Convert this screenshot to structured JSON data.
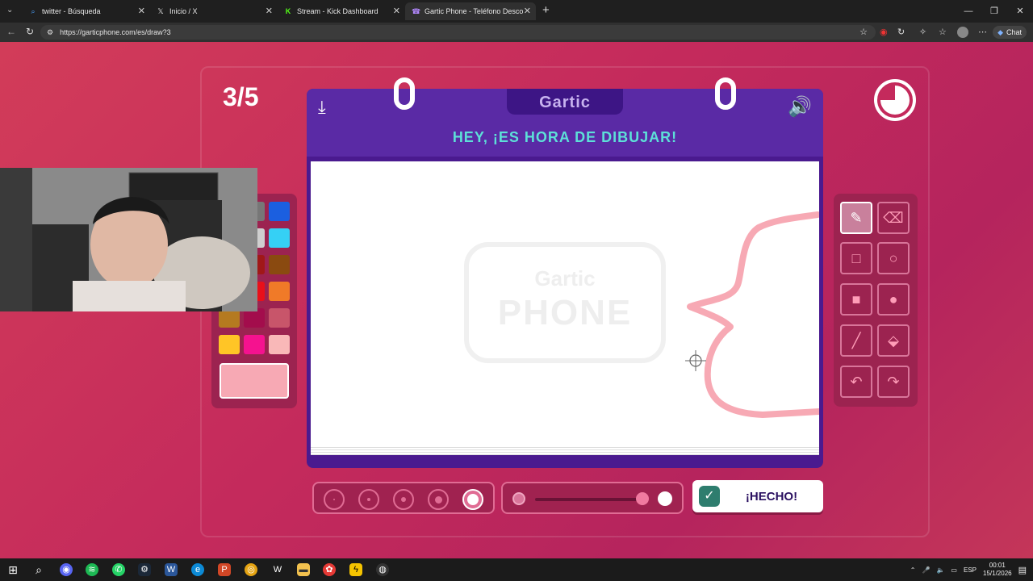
{
  "browser": {
    "tabs": [
      {
        "title": "twitter - Búsqueda",
        "favicon": "search-icon"
      },
      {
        "title": "Inicio / X",
        "favicon": "x-icon"
      },
      {
        "title": "Stream - Kick Dashboard",
        "favicon": "kick-icon"
      },
      {
        "title": "Gartic Phone - Teléfono Descomp",
        "favicon": "gartic-icon",
        "active": true
      }
    ],
    "new_tab": "+",
    "url": "https://garticphone.com/es/draw?3",
    "chat_label": "Chat"
  },
  "game": {
    "round": "3/5",
    "logo": "Gartic",
    "headline": "HEY, ¡ES HORA DE DIBUJAR!",
    "watermark_top": "Gartic",
    "watermark_bottom": "PHONE",
    "done_label": "¡HECHO!",
    "selected_color": "#f7a9b4",
    "palette": [
      "#1a1a1a",
      "#777777",
      "#1b5fe0",
      "#ffffff",
      "#cfcfcf",
      "#35d0f5",
      "#0d7a2d",
      "#a01818",
      "#8a4a10",
      "#1fcc4a",
      "#e8101a",
      "#f07a28",
      "#b57a20",
      "#a30d4c",
      "#c8556a",
      "#ffc526",
      "#f5128f",
      "#f9b8b8"
    ],
    "tools": [
      {
        "name": "pencil",
        "selected": true
      },
      {
        "name": "eraser"
      },
      {
        "name": "rectangle-outline"
      },
      {
        "name": "ellipse-outline"
      },
      {
        "name": "rectangle-filled"
      },
      {
        "name": "ellipse-filled"
      },
      {
        "name": "line"
      },
      {
        "name": "fill-bucket"
      },
      {
        "name": "undo"
      },
      {
        "name": "redo"
      }
    ],
    "brush_sizes": 5,
    "selected_size_index": 4
  },
  "taskbar": {
    "lang": "ESP",
    "time": "00:01",
    "date": "15/1/2026"
  }
}
